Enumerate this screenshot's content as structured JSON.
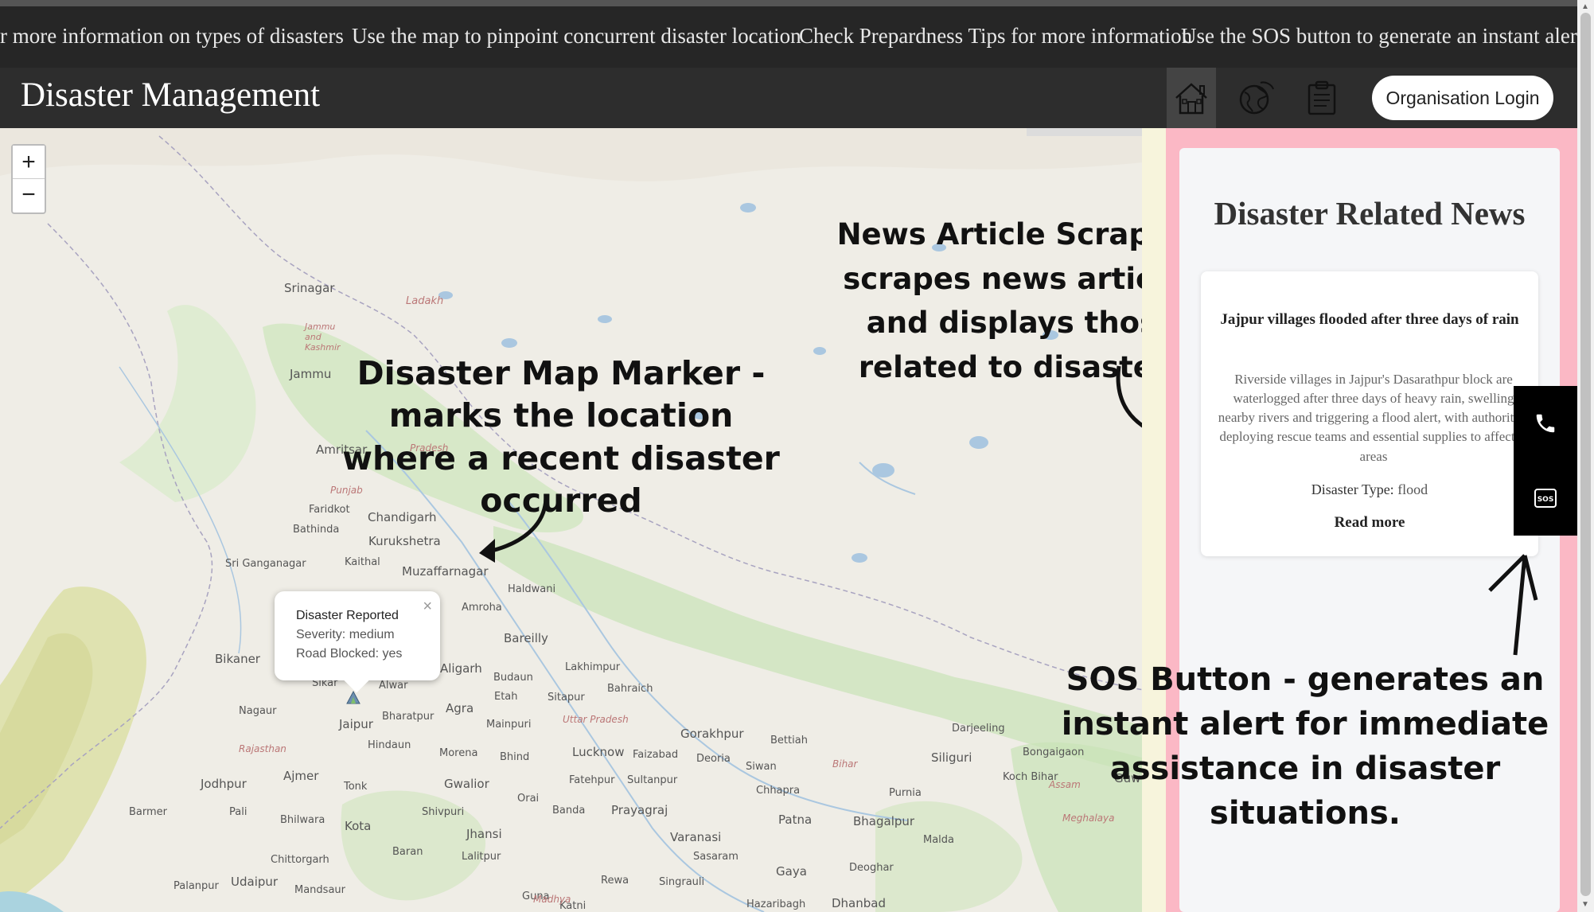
{
  "ticker": {
    "items": [
      "r more information on types of disasters",
      "Use the map to pinpoint concurrent disaster location",
      "Check Prepardness Tips for more information",
      "Use the SOS button to generate an instant alert"
    ]
  },
  "header": {
    "brand": "Disaster Management",
    "nav_icons": [
      "home-icon",
      "world-icon",
      "clipboard-icon"
    ],
    "login_label": "Organisation Login"
  },
  "map": {
    "zoom_in": "+",
    "zoom_out": "−",
    "places": [
      "Srinagar",
      "Ladakh",
      "Jammu",
      "Amritsar",
      "Chandigarh",
      "Kurukshetra",
      "Muzaffarnagar",
      "Faridkot",
      "Bathinda",
      "Kaithal",
      "Sri Ganganagar",
      "Bikaner",
      "Sikar",
      "Alwar",
      "Jaipur",
      "Agra",
      "Aligarh",
      "Bareilly",
      "Amroha",
      "Haldwani",
      "Budaun",
      "Etah",
      "Mainpuri",
      "Nagaur",
      "Jodhpur",
      "Ajmer",
      "Tonk",
      "Gwalior",
      "Lucknow",
      "Sitapur",
      "Faizabad",
      "Gorakhpur",
      "Deoria",
      "Siwan",
      "Bettiah",
      "Patna",
      "Bhagalpur",
      "Purnia",
      "Siliguri",
      "Darjeeling",
      "Barmer",
      "Pali",
      "Bhilwara",
      "Kota",
      "Jhansi",
      "Prayagraj",
      "Varanasi",
      "Gaya",
      "Deoghar",
      "Dhanbad",
      "Udaipur",
      "Chittorgarh",
      "Banda",
      "Orai",
      "Shivpuri",
      "Hindaun",
      "Bharatpur",
      "Morena",
      "Bhind",
      "Fatehpur",
      "Sultanpur",
      "Chhapra",
      "Malda",
      "Bongaigaon",
      "Koch Bihar",
      "Guw",
      "Rajasthan",
      "Uttar Pradesh",
      "Bihar",
      "Assam",
      "Meghalaya",
      "Punjab",
      "Jammu and Kashmir",
      "Pradesh",
      "Sasaram",
      "Rewa",
      "Singrauli",
      "Katni",
      "Hazaribagh",
      "Palanpur",
      "Mandsaur",
      "Lalitpur",
      "Guna",
      "Baran",
      "Bahraich",
      "Lakhimpur",
      "Madhya"
    ],
    "popup": {
      "title": "Disaster Reported",
      "severity": "Severity: medium",
      "road": "Road Blocked: yes",
      "close": "×"
    }
  },
  "annotations": {
    "marker": "Disaster Map Marker - marks the location where a recent disaster occurred",
    "news": "News Article Scraper - scrapes news articles and displays those related to disasters",
    "sos": "SOS Button - generates an instant alert for immediate assistance in disaster situations."
  },
  "news": {
    "heading": "Disaster Related News",
    "card": {
      "title": "Jajpur villages flooded after three days of rain",
      "description": "Riverside villages in Jajpur's Dasarathpur block are waterlogged after three days of heavy rain, swelling nearby rivers and triggering a flood alert, with authorities deploying rescue teams and essential supplies to affected areas",
      "type_label": "Disaster Type:",
      "type_value": "flood",
      "read_more": "Read more"
    }
  },
  "floating": {
    "call_icon": "phone-icon",
    "sos_icon": "sos-icon",
    "sos_text": "SOS"
  }
}
